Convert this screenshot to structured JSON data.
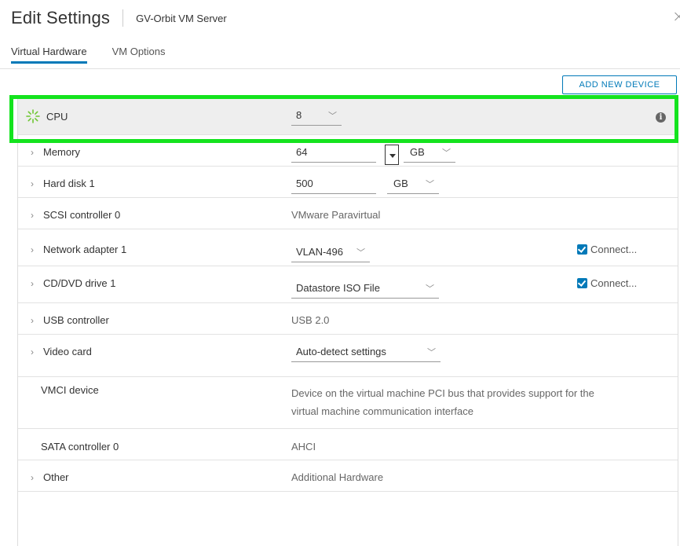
{
  "header": {
    "title": "Edit Settings",
    "subtitle": "GV-Orbit VM Server"
  },
  "tabs": [
    {
      "label": "Virtual Hardware",
      "active": true
    },
    {
      "label": "VM Options",
      "active": false
    }
  ],
  "toolbar": {
    "add_device_label": "ADD NEW DEVICE"
  },
  "colors": {
    "accent": "#0079b8",
    "highlight": "#14e31e",
    "spinner": "#6ec632"
  },
  "rows": {
    "cpu": {
      "label": "CPU",
      "value": "8",
      "icon": "loading-spinner-icon"
    },
    "memory": {
      "label": "Memory",
      "value": "64",
      "unit": "GB"
    },
    "hard_disk": {
      "label": "Hard disk 1",
      "value": "500",
      "unit": "GB"
    },
    "scsi": {
      "label": "SCSI controller 0",
      "value": "VMware Paravirtual"
    },
    "network": {
      "label": "Network adapter 1",
      "value": "VLAN-496",
      "connect_label": "Connect...",
      "connected": true
    },
    "cddvd": {
      "label": "CD/DVD drive 1",
      "value": "Datastore ISO File",
      "connect_label": "Connect...",
      "connected": true
    },
    "usb": {
      "label": "USB controller",
      "value": "USB 2.0"
    },
    "video": {
      "label": "Video card",
      "value": "Auto-detect settings"
    },
    "vmci": {
      "label": "VMCI device",
      "value_line1": "Device on the virtual machine PCI bus that provides support for the",
      "value_line2": "virtual machine communication interface"
    },
    "sata": {
      "label": "SATA controller 0",
      "value": "AHCI"
    },
    "other": {
      "label": "Other",
      "value": "Additional Hardware"
    }
  }
}
